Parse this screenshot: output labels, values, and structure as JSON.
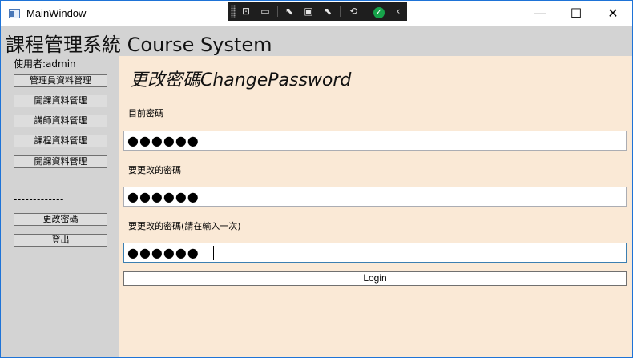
{
  "window": {
    "title": "MainWindow",
    "controls": {
      "minimize": "—",
      "maximize": "☐",
      "close": "✕"
    }
  },
  "devbar": {
    "tools": [
      "⊡",
      "▭",
      "⬉",
      "▣",
      "⬉",
      "⟲",
      "✓",
      "‹"
    ]
  },
  "header": {
    "title": "課程管理系統 Course System"
  },
  "sidebar": {
    "user": "使用者:admin",
    "items": [
      {
        "label": "管理員資料管理"
      },
      {
        "label": "開課資料管理"
      },
      {
        "label": "講師資料管理"
      },
      {
        "label": "課程資料管理"
      },
      {
        "label": "開課資料管理"
      }
    ],
    "divider": "-------------",
    "change_password": "更改密碼",
    "logout": "登出"
  },
  "main": {
    "title": "更改密碼ChangePassword",
    "current_label": "目前密碼",
    "current_value": "●●●●●●",
    "new_label": "要更改的密碼",
    "new_value": "●●●●●●",
    "confirm_label": "要更改的密碼(請在輸入一次)",
    "confirm_value": "●●●●●●",
    "submit": "Login"
  }
}
